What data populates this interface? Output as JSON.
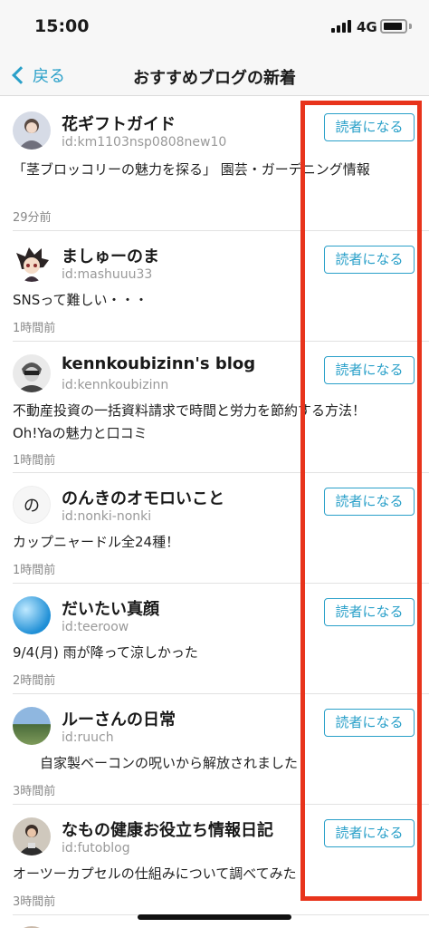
{
  "status": {
    "time": "15:00",
    "network": "4G"
  },
  "nav": {
    "back_label": "戻る",
    "title": "おすすめブログの新着"
  },
  "subscribe_label": "読者になる",
  "items": [
    {
      "name": "花ギフトガイド",
      "id": "id:km1103nsp0808new10",
      "desc": "「茎ブロッコリーの魅力を探る」 園芸・ガーデニング情報",
      "time": "29分前"
    },
    {
      "name": "ましゅーのま",
      "id": "id:mashuuu33",
      "desc": "SNSって難しい・・・",
      "time": "1時間前"
    },
    {
      "name": "kennkoubizinn's blog",
      "id": "id:kennkoubizinn",
      "desc": "不動産投資の一括資料請求で時間と労力を節約する方法！Oh!Yaの魅力と口コミ",
      "time": "1時間前"
    },
    {
      "name": "のんきのオモロいこと",
      "id": "id:nonki-nonki",
      "desc": "カップニャードル全24種！",
      "time": "1時間前",
      "avatar_char": "の"
    },
    {
      "name": "だいたい真顔",
      "id": "id:teeroow",
      "desc": "9/4(月) 雨が降って涼しかった",
      "time": "2時間前"
    },
    {
      "name": "ルーさんの日常",
      "id": "id:ruuch",
      "desc": "　　自家製ベーコンの呪いから解放されました",
      "time": "3時間前"
    },
    {
      "name": "なもの健康お役立ち情報日記",
      "id": "id:futoblog",
      "desc": "オーツーカプセルの仕組みについて調べてみた",
      "time": "3時間前"
    }
  ]
}
